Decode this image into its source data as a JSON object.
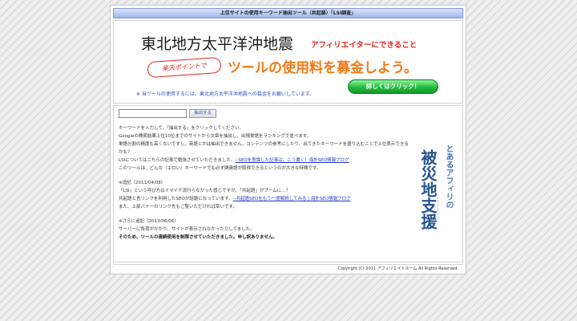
{
  "header": {
    "title": "上位サイトの使用キーワード抽出ツール（共起語）「LSI調査」"
  },
  "banner": {
    "title_main": "東北地方太平洋沖地震",
    "title_sub": "アフィリエイターにできること",
    "stamp": "楽天ポイントで",
    "title_big": "ツールの使用料を募金しよう。",
    "note": "※ 当ツールの使用するには、東北地方太平洋沖地震への募金をお願いしています。",
    "detail_button": "詳しくはクリック！"
  },
  "search": {
    "value": "",
    "placeholder": "",
    "button": "抽出する"
  },
  "body": {
    "p1": "キーワードを入力して、「抽出する」をクリックしてください。",
    "p2": "Googleの検索結果上位10位までのサイトから文章を抽出し、出現単語をランキングで並べます。",
    "p3": "単語分割の精度も高くないですし、英語とかは抽出できません。コンテンツの参考にしたり、出てきたキーワードを盛り込むことで上位表示できるかも？",
    "p4": "LSIについてはこちらの記事で勉強させていただきました。",
    "p4_link": "--SEOを意識した記事は、こう書く！海外SEO情報ブログ",
    "p5": "このツールは、どんな（エロい）キーワードでも必ず関連語が取得できるというのが大きな特徴です。",
    "p6": "※追記（2011/04/08）",
    "p7": "「LSI」という呼び方はイマイチ流行らなかった感じですが、「共起語」がブームに…？",
    "p8": "共起語と言リンクを利用したSEOが話題になっています。",
    "p8_link": "--共起語SEOをもう一度解説してみる | 海外SEO情報ブログ",
    "p9": "また、上部バナーのリンク先もご覧いただければ幸いです。",
    "p10": "※さらに追記（2013/06/06）",
    "p11": "サーバーに負荷がかかり、サイトが表示されなかったりしてました。",
    "p12": "そのため、ツールの連続使用を制限させていただきました。申し訳ありません。"
  },
  "side_banner": {
    "line1": "とあるアフィリの",
    "line2": "被災地支援"
  },
  "footer": {
    "copyright": "Copyright (C) 2011 アフィリエイトルーム All Rights Reserved."
  }
}
